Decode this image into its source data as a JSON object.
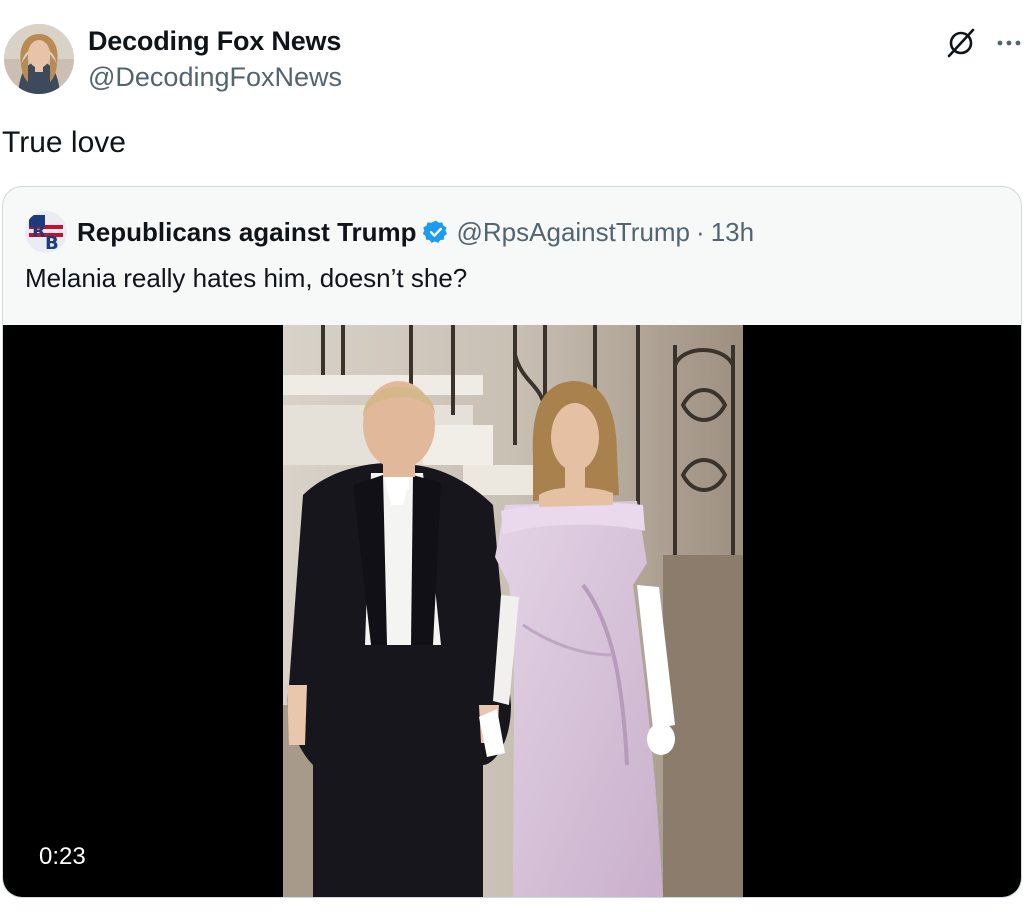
{
  "post": {
    "author_name": "Decoding Fox News",
    "author_handle": "@DecodingFoxNews",
    "text": "True love",
    "icons": {
      "grok": "grok-slash-icon",
      "more": "more-dots-icon"
    }
  },
  "quoted": {
    "author_name": "Republicans against Trump",
    "verified": true,
    "author_handle": "@RpsAgainstTrump",
    "separator": "·",
    "time": "13h",
    "text": "Melania really hates him, doesn’t she?",
    "video_duration": "0:23"
  },
  "colors": {
    "text": "#0f1419",
    "secondary": "#536471",
    "verified_blue": "#1d9bf0",
    "border": "#cfd9de",
    "media_bg": "#000000"
  }
}
